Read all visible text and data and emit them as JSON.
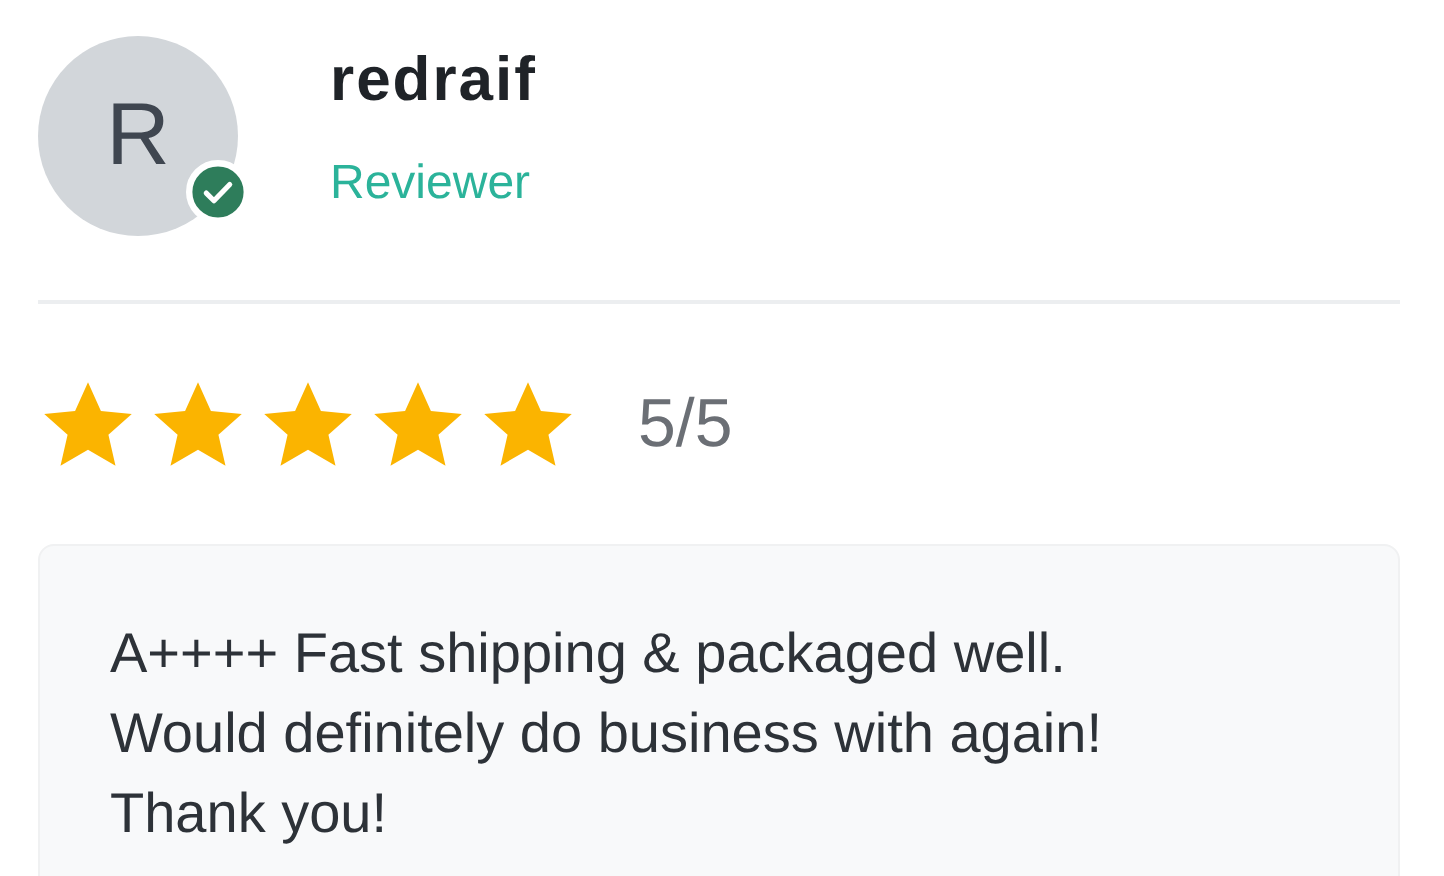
{
  "reviewer": {
    "initial": "R",
    "verified": true,
    "name": "redraif",
    "role": "Reviewer"
  },
  "rating": {
    "stars": 5,
    "label": "5/5"
  },
  "review": {
    "text": "A++++ Fast shipping & packaged well. Would definitely do business with again! Thank you!"
  }
}
